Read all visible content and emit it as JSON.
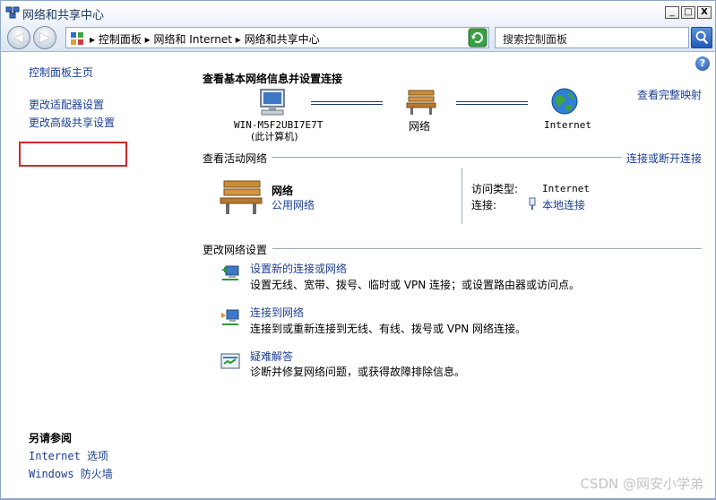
{
  "window": {
    "title": "网络和共享中心",
    "min_label": "_",
    "max_label": "□",
    "close_label": "X"
  },
  "address": {
    "breadcrumb": "▸ 控制面板 ▸ 网络和 Internet ▸ 网络和共享中心",
    "dropdown": "▾",
    "search_placeholder": "搜索控制面板"
  },
  "sidebar": {
    "home": "控制面板主页",
    "adapter": "更改适配器设置",
    "advanced_sharing": "更改高级共享设置",
    "see_also": "另请参阅",
    "internet_options": "Internet 选项",
    "firewall": "Windows 防火墙"
  },
  "main": {
    "help": "?",
    "heading": "查看基本网络信息并设置连接",
    "full_map": "查看完整映射",
    "map": {
      "computer_name": "WIN-M5F2UBI7E7T",
      "computer_sub": "(此计算机)",
      "network": "网络",
      "internet": "Internet"
    },
    "active_heading": "查看活动网络",
    "connect_disconnect": "连接或断开连接",
    "active": {
      "name": "网络",
      "type": "公用网络",
      "access_label": "访问类型:",
      "access_value": "Internet",
      "conn_label": "连接:",
      "conn_value": "本地连接"
    },
    "change_heading": "更改网络设置",
    "tasks": [
      {
        "title": "设置新的连接或网络",
        "desc": "设置无线、宽带、拨号、临时或 VPN 连接；或设置路由器或访问点。"
      },
      {
        "title": "连接到网络",
        "desc": "连接到或重新连接到无线、有线、拨号或 VPN 网络连接。"
      },
      {
        "title": "疑难解答",
        "desc": "诊断并修复网络问题，或获得故障排除信息。"
      }
    ]
  },
  "watermark": "CSDN @网安小学弟"
}
